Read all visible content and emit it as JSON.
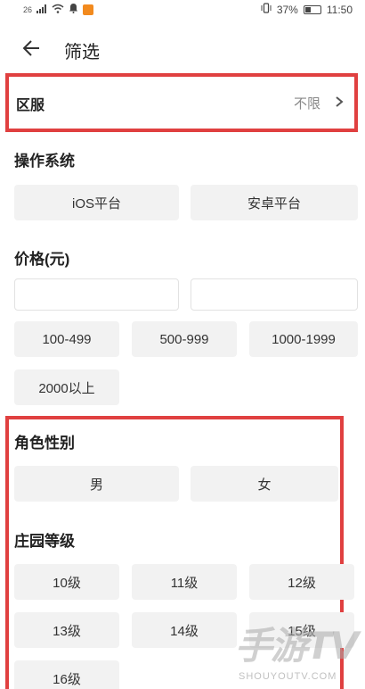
{
  "status_bar": {
    "signal": "26",
    "battery_percent": "37%",
    "time": "11:50"
  },
  "header": {
    "title": "筛选"
  },
  "region": {
    "label": "区服",
    "value": "不限"
  },
  "os": {
    "title": "操作系统",
    "options": [
      "iOS平台",
      "安卓平台"
    ]
  },
  "price": {
    "title": "价格(元)",
    "min_value": "",
    "max_value": "",
    "ranges": [
      "100-499",
      "500-999",
      "1000-1999",
      "2000以上"
    ]
  },
  "gender": {
    "title": "角色性别",
    "options": [
      "男",
      "女"
    ]
  },
  "manor": {
    "title": "庄园等级",
    "levels": [
      "10级",
      "11级",
      "12级",
      "13级",
      "14级",
      "15级",
      "16级"
    ]
  },
  "watermark": {
    "main": "手游TV",
    "sub": "SHOUYOUTV.COM"
  },
  "colors": {
    "highlight_border": "#e04040",
    "chip_bg": "#f2f2f2",
    "muted_text": "#888888"
  }
}
